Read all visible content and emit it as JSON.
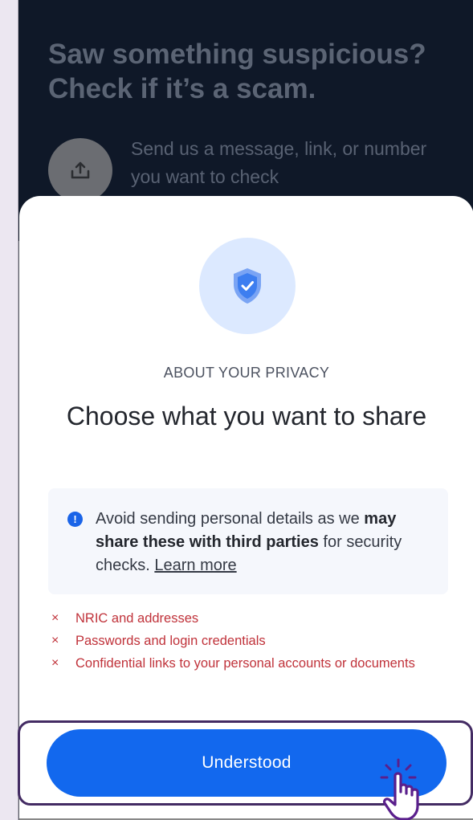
{
  "background": {
    "title": "Saw something suspicious? Check if it’s a scam.",
    "upload_icon": "upload-icon",
    "description": "Send us a message, link, or number you want to check"
  },
  "sheet": {
    "shield_icon": "shield-check-icon",
    "eyebrow": "ABOUT YOUR PRIVACY",
    "headline": "Choose what you want to share",
    "info": {
      "icon": "exclamation-icon",
      "text_before": "Avoid sending personal details as we ",
      "text_bold": "may share these with third parties",
      "text_after": " for security checks. ",
      "link": "Learn more"
    },
    "warnings": [
      "NRIC and addresses",
      "Passwords and login credentials",
      "Confidential links to your personal accounts or documents"
    ],
    "warning_icon": "×",
    "button_label": "Understood"
  },
  "colors": {
    "accent": "#1268ee",
    "warning": "#c0323a",
    "highlight": "#432b63"
  }
}
